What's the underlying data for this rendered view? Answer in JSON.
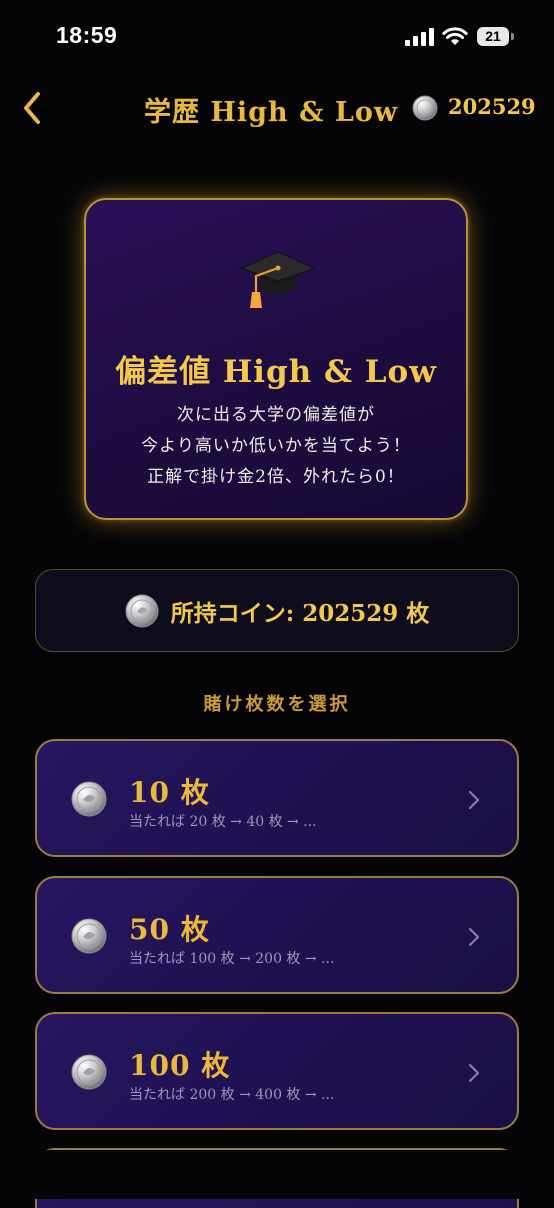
{
  "status_bar": {
    "time": "18:59",
    "battery": "21",
    "icons": [
      "signal-icon",
      "wifi-icon",
      "battery-icon"
    ]
  },
  "header": {
    "back_icon": "chevron-left-icon",
    "title": "学歴 High & Low",
    "coin_icon": "silver-coin-icon",
    "coins": "202529"
  },
  "hero": {
    "icon": "graduation-cap-icon",
    "title": "偏差値 High & Low",
    "description": [
      "次に出る大学の偏差値が",
      "今より高いか低いかを当てよう！",
      "正解で掛け金2倍、外れたら0！"
    ]
  },
  "balance": {
    "icon": "silver-coin-icon",
    "text": "所持コイン: 202529 枚"
  },
  "section_label": "賭け枚数を選択",
  "bets": [
    {
      "amount": "10 枚",
      "subtitle": "当たれば 20 枚 → 40 枚 → ..."
    },
    {
      "amount": "50 枚",
      "subtitle": "当たれば 100 枚 → 200 枚 → ..."
    },
    {
      "amount": "100 枚",
      "subtitle": "当たれば 200 枚 → 400 枚 → ..."
    }
  ],
  "colors": {
    "background": "#050508",
    "gold": "#f2c94c",
    "card_purple": "#281660",
    "card_border": "#9b7c3e"
  }
}
